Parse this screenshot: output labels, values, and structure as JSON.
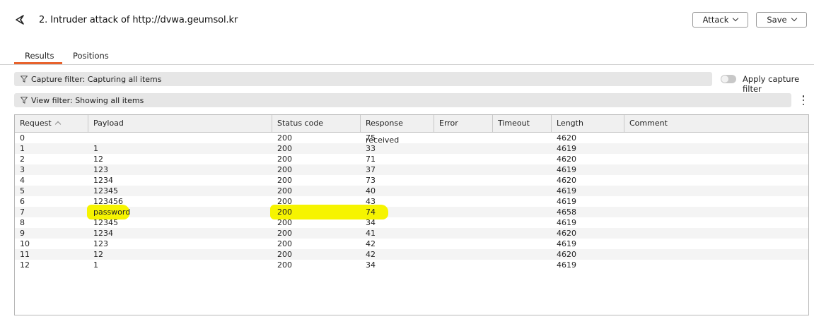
{
  "window": {
    "title": "2. Intruder attack of http://dvwa.geumsol.kr",
    "attack_label": "Attack",
    "save_label": "Save"
  },
  "tabs": [
    {
      "label": "Results",
      "active": true
    },
    {
      "label": "Positions",
      "active": false
    }
  ],
  "filters": {
    "capture": "Capture filter: Capturing all items",
    "view": "View filter: Showing all items",
    "apply_capture_label": "Apply capture filter",
    "apply_capture_enabled": false
  },
  "table": {
    "columns": [
      "Request",
      "Payload",
      "Status code",
      "Response received",
      "Error",
      "Timeout",
      "Length",
      "Comment"
    ],
    "sorted_by": "Request",
    "rows": [
      {
        "request": "0",
        "payload": "",
        "status": "200",
        "response": "75",
        "error": "",
        "timeout": "",
        "length": "4620",
        "comment": ""
      },
      {
        "request": "1",
        "payload": "1",
        "status": "200",
        "response": "33",
        "error": "",
        "timeout": "",
        "length": "4619",
        "comment": ""
      },
      {
        "request": "2",
        "payload": "12",
        "status": "200",
        "response": "71",
        "error": "",
        "timeout": "",
        "length": "4620",
        "comment": ""
      },
      {
        "request": "3",
        "payload": "123",
        "status": "200",
        "response": "37",
        "error": "",
        "timeout": "",
        "length": "4619",
        "comment": ""
      },
      {
        "request": "4",
        "payload": "1234",
        "status": "200",
        "response": "73",
        "error": "",
        "timeout": "",
        "length": "4620",
        "comment": ""
      },
      {
        "request": "5",
        "payload": "12345",
        "status": "200",
        "response": "40",
        "error": "",
        "timeout": "",
        "length": "4619",
        "comment": ""
      },
      {
        "request": "6",
        "payload": "123456",
        "status": "200",
        "response": "43",
        "error": "",
        "timeout": "",
        "length": "4619",
        "comment": ""
      },
      {
        "request": "7",
        "payload": "password",
        "status": "200",
        "response": "74",
        "error": "",
        "timeout": "",
        "length": "4658",
        "comment": "",
        "highlighted": true
      },
      {
        "request": "8",
        "payload": "12345",
        "status": "200",
        "response": "34",
        "error": "",
        "timeout": "",
        "length": "4619",
        "comment": ""
      },
      {
        "request": "9",
        "payload": "1234",
        "status": "200",
        "response": "41",
        "error": "",
        "timeout": "",
        "length": "4620",
        "comment": ""
      },
      {
        "request": "10",
        "payload": "123",
        "status": "200",
        "response": "42",
        "error": "",
        "timeout": "",
        "length": "4619",
        "comment": ""
      },
      {
        "request": "11",
        "payload": "12",
        "status": "200",
        "response": "42",
        "error": "",
        "timeout": "",
        "length": "4620",
        "comment": ""
      },
      {
        "request": "12",
        "payload": "1",
        "status": "200",
        "response": "34",
        "error": "",
        "timeout": "",
        "length": "4619",
        "comment": ""
      }
    ]
  },
  "colors": {
    "accent": "#e8622c",
    "highlight": "#f6f400"
  }
}
